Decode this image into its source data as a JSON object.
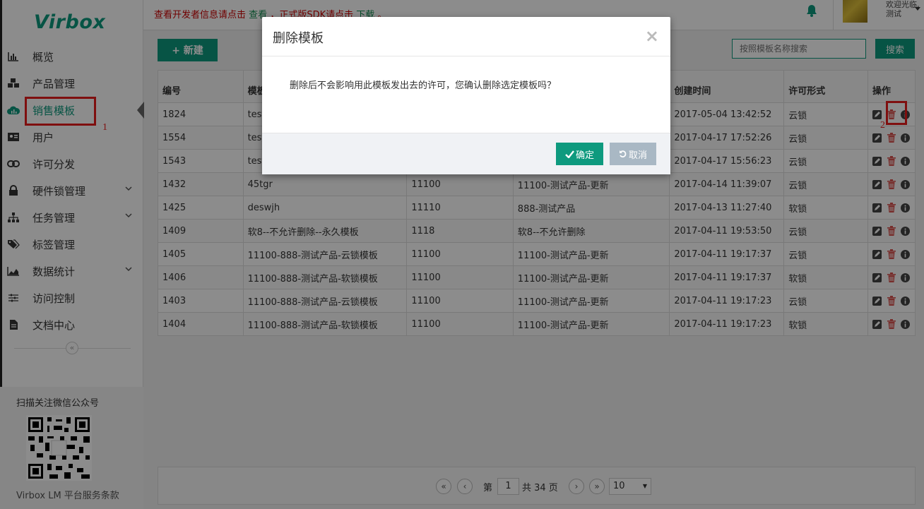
{
  "brand": "Virbox",
  "topbar": {
    "notice_prefix": "查看开发者信息请点击",
    "notice_link1": "查看",
    "notice_mid": "，正式版SDK请点击",
    "notice_link2": "下载",
    "notice_end": "。",
    "welcome_line1": "欢迎光临,",
    "welcome_line2": "测试"
  },
  "sidebar": {
    "items": [
      {
        "label": "概览",
        "icon": "bar-chart-icon"
      },
      {
        "label": "产品管理",
        "icon": "cubes-icon"
      },
      {
        "label": "销售模板",
        "icon": "cloud-chart-icon"
      },
      {
        "label": "用户",
        "icon": "id-card-icon"
      },
      {
        "label": "许可分发",
        "icon": "link-icon"
      },
      {
        "label": "硬件锁管理",
        "icon": "lock-icon"
      },
      {
        "label": "任务管理",
        "icon": "sitemap-icon"
      },
      {
        "label": "标签管理",
        "icon": "tags-icon"
      },
      {
        "label": "数据统计",
        "icon": "area-chart-icon"
      },
      {
        "label": "访问控制",
        "icon": "sliders-icon"
      },
      {
        "label": "文档中心",
        "icon": "file-icon"
      }
    ],
    "collapse_symbol": "«",
    "wechat_title": "扫描关注微信公众号",
    "terms": "Virbox LM 平台服务条款",
    "annotation_1": "1"
  },
  "toolbar": {
    "new_label": "+ 新建",
    "search_placeholder": "按照模板名称搜索",
    "search_label": "搜索"
  },
  "table": {
    "headers": [
      "编号",
      "模板",
      "",
      "",
      "创建时间",
      "许可形式",
      "操作"
    ],
    "rows": [
      {
        "id": "1824",
        "name": "test",
        "code": "",
        "product": "",
        "created": "2017-05-04 13:42:52",
        "type": "云锁"
      },
      {
        "id": "1554",
        "name": "test",
        "code": "",
        "product": "",
        "created": "2017-04-17 17:52:26",
        "type": "云锁"
      },
      {
        "id": "1543",
        "name": "test",
        "code": "",
        "product": "",
        "created": "2017-04-17 15:56:23",
        "type": "云锁"
      },
      {
        "id": "1432",
        "name": "45tgr",
        "code": "11100",
        "product": "11100-测试产品-更新",
        "created": "2017-04-14 11:39:07",
        "type": "云锁"
      },
      {
        "id": "1425",
        "name": "deswjh",
        "code": "11110",
        "product": "888-测试产品",
        "created": "2017-04-13 11:27:40",
        "type": "软锁"
      },
      {
        "id": "1409",
        "name": "软8--不允许删除--永久模板",
        "code": "1118",
        "product": "软8--不允许删除",
        "created": "2017-04-11 19:53:50",
        "type": "云锁"
      },
      {
        "id": "1405",
        "name": "11100-888-测试产品-云锁模板",
        "code": "11100",
        "product": "11100-测试产品-更新",
        "created": "2017-04-11 19:17:37",
        "type": "云锁"
      },
      {
        "id": "1406",
        "name": "11100-888-测试产品-软锁模板",
        "code": "11100",
        "product": "11100-测试产品-更新",
        "created": "2017-04-11 19:17:37",
        "type": "软锁"
      },
      {
        "id": "1403",
        "name": "11100-888-测试产品-云锁模板",
        "code": "11100",
        "product": "11100-测试产品-更新",
        "created": "2017-04-11 19:17:23",
        "type": "云锁"
      },
      {
        "id": "1404",
        "name": "11100-888-测试产品-软锁模板",
        "code": "11100",
        "product": "11100-测试产品-更新",
        "created": "2017-04-11 19:17:23",
        "type": "软锁"
      }
    ],
    "annotation_2": "2"
  },
  "pager": {
    "first": "«",
    "prev": "‹",
    "page_prefix": "第",
    "current_page": "1",
    "total_text": "共 34 页",
    "next": "›",
    "last": "»",
    "page_size": "10"
  },
  "modal": {
    "title": "删除模板",
    "close": "×",
    "message": "删除后不会影响用此模板发出去的许可，您确认删除选定模板吗？",
    "ok_label": "确定",
    "cancel_label": "取消"
  },
  "colors": {
    "accent": "#0e9a7e",
    "danger": "#d9534f",
    "annotation": "#e81c1c"
  }
}
